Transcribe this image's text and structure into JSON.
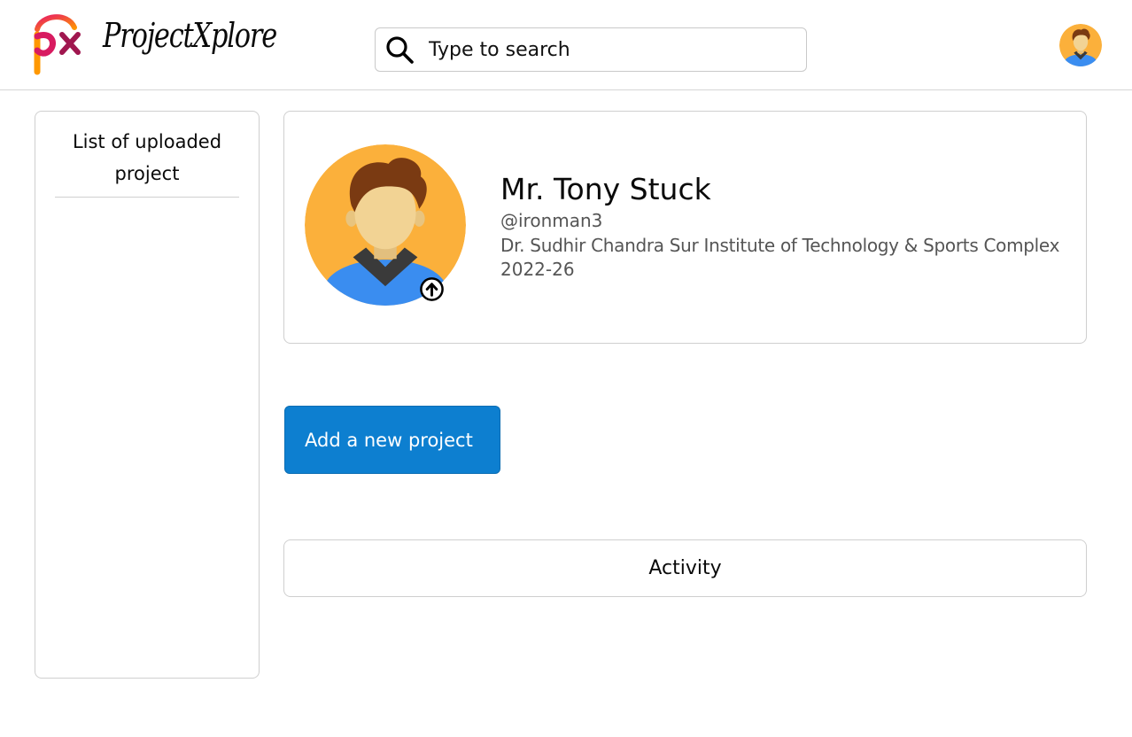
{
  "header": {
    "logo_text": "ProjectXplore",
    "logo_mark": "px",
    "search": {
      "placeholder": "Type to search",
      "value": ""
    },
    "avatar_icon": "user-avatar-icon"
  },
  "sidebar": {
    "title": "List of uploaded project"
  },
  "profile": {
    "name": "Mr. Tony Stuck",
    "handle": "@ironman3",
    "institute": "Dr. Sudhir Chandra Sur Institute of Technology & Sports Complex",
    "session": "2022-26",
    "upload_icon": "upload-arrow-icon"
  },
  "actions": {
    "add_project_label": "Add a new project"
  },
  "activity": {
    "label": "Activity"
  },
  "colors": {
    "primary_button": "#0d7fd0",
    "avatar_bg": "#fbb03b",
    "shirt": "#3a8df0",
    "hair": "#7a3a12",
    "skin": "#f2d394",
    "logo_pink": "#d81b60",
    "logo_orange": "#f57c00"
  }
}
